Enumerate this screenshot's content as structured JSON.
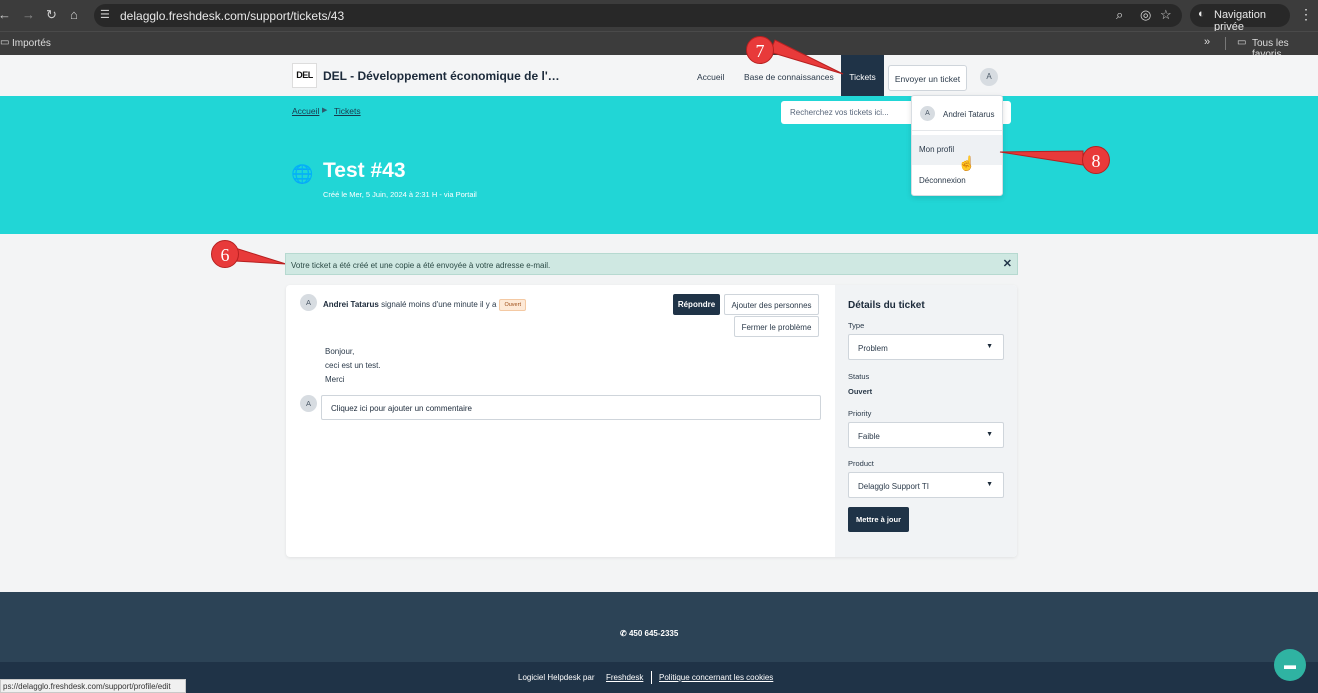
{
  "browser": {
    "url": "delagglo.freshdesk.com/support/tickets/43",
    "bookmark_imported": "Importés",
    "private_label": "Navigation privée",
    "all_favorites": "Tous les favoris",
    "status_url": "https://delagglo.freshdesk.com/support/profile/edit",
    "status_url_display": "ps://delagglo.freshdesk.com/support/profile/edit"
  },
  "header": {
    "logo_text": "DEL",
    "site_title": "DEL - Développement économique de l'…",
    "nav": {
      "home": "Accueil",
      "knowledge_base": "Base de connaissances",
      "tickets": "Tickets",
      "submit_ticket": "Envoyer un ticket"
    },
    "avatar_initial": "A"
  },
  "band": {
    "breadcrumb_home": "Accueil",
    "breadcrumb_tickets": "Tickets",
    "search_placeholder": "Recherchez vos tickets ici...",
    "ticket_title": "Test #43",
    "created_line": "Créé le Mer, 5 Juin, 2024 à 2:31 H - via Portail"
  },
  "profile_menu": {
    "avatar_initial": "A",
    "user_name": "Andrei Tatarus",
    "my_profile": "Mon profil",
    "logout": "Déconnexion"
  },
  "annotations": {
    "marker_6": "6",
    "marker_7": "7",
    "marker_8": "8",
    "accent_color": "#e83a3a"
  },
  "alert": {
    "message": "Votre ticket a été créé et une copie a été envoyée à votre adresse e-mail.",
    "close_glyph": "✕"
  },
  "conversation": {
    "avatar_initial": "A",
    "author": "Andrei Tatarus",
    "action_text": " signalé moins d'une minute il y a",
    "status_badge": "Ouvert",
    "reply_button": "Répondre",
    "add_people_button": "Ajouter des personnes",
    "close_issue_button": "Fermer le problème",
    "body_lines": [
      "Bonjour,",
      "ceci est un test.",
      "Merci"
    ],
    "comment_placeholder": "Cliquez ici pour ajouter un commentaire"
  },
  "details": {
    "title": "Détails du ticket",
    "type_label": "Type",
    "type_value": "Problem",
    "status_label": "Status",
    "status_value": "Ouvert",
    "priority_label": "Priority",
    "priority_value": "Faible",
    "product_label": "Product",
    "product_value": "Delagglo Support TI",
    "update_button": "Mettre à jour"
  },
  "footer": {
    "phone": "450 645-2335",
    "powered_text": "Logiciel Helpdesk par",
    "freshdesk_link": "Freshdesk",
    "cookies_link": "Politique concernant les cookies"
  },
  "colors": {
    "teal_band": "#21d6d6",
    "navy": "#1f3347",
    "footer": "#2c4356"
  }
}
